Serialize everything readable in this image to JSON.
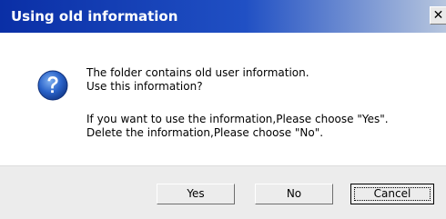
{
  "window": {
    "title": "Using old information",
    "close_glyph": "✕"
  },
  "message": {
    "icon": "question-icon",
    "line1": "The folder contains old user information.",
    "line2": "Use this information?",
    "line3": "If you want to use the information,Please choose \"Yes\".",
    "line4": "Delete the information,Please choose \"No\"."
  },
  "buttons": {
    "yes": "Yes",
    "no": "No",
    "cancel": "Cancel"
  },
  "colors": {
    "titlebar_start": "#0a2fa6",
    "titlebar_end": "#b7c6de",
    "icon_blue": "#2a63c9",
    "footer_bg": "#ececec"
  }
}
